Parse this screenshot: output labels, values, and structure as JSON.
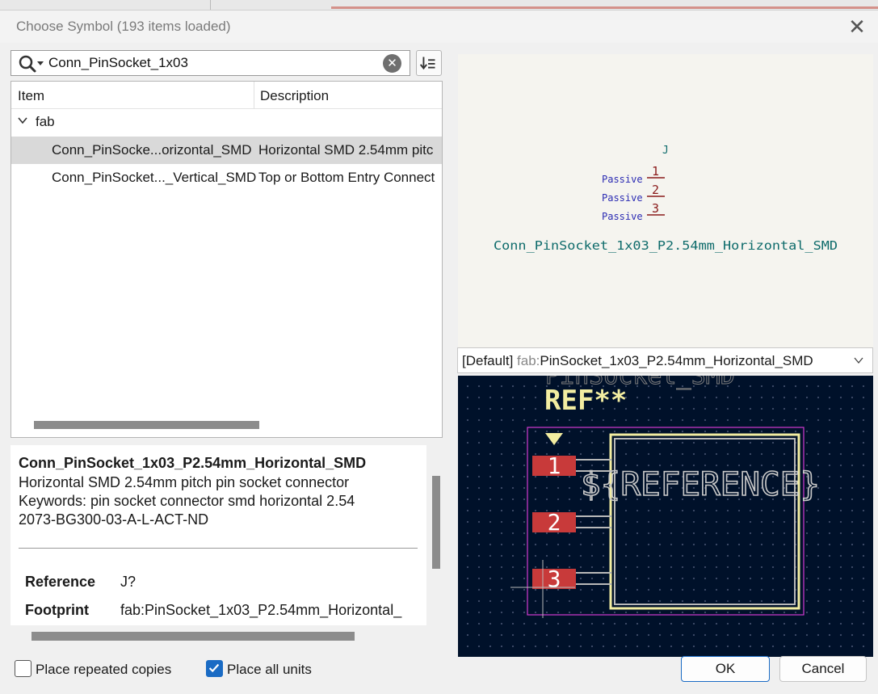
{
  "dialog": {
    "title": "Choose Symbol (193 items loaded)"
  },
  "search": {
    "value": "Conn_PinSocket_1x03",
    "clear_glyph": "✕"
  },
  "tree": {
    "columns": [
      "Item",
      "Description"
    ],
    "group": "fab",
    "rows": [
      {
        "name": "Conn_PinSocke...orizontal_SMD",
        "desc": "Horizontal SMD 2.54mm pitc"
      },
      {
        "name": "Conn_PinSocket..._Vertical_SMD",
        "desc": "Top or Bottom Entry Connect"
      }
    ]
  },
  "details": {
    "title": "Conn_PinSocket_1x03_P2.54mm_Horizontal_SMD",
    "lines": [
      "Horizontal SMD 2.54mm pitch pin socket connector",
      "Keywords: pin socket connector smd horizontal 2.54",
      "2073-BG300-03-A-L-ACT-ND"
    ],
    "fields": [
      {
        "key": "Reference",
        "value": "J?"
      },
      {
        "key": "Footprint",
        "value": "fab:PinSocket_1x03_P2.54mm_Horizontal_"
      }
    ]
  },
  "symbol_preview": {
    "reference": "J",
    "pins": [
      {
        "type": "Passive",
        "number": "1"
      },
      {
        "type": "Passive",
        "number": "2"
      },
      {
        "type": "Passive",
        "number": "3"
      }
    ],
    "value": "Conn_PinSocket_1x03_P2.54mm_Horizontal_SMD"
  },
  "footprint_select": {
    "prefix": "[Default] ",
    "lib": "fab:",
    "name": "PinSocket_1x03_P2.54mm_Horizontal_SMD"
  },
  "footprint_preview": {
    "ref_label": "REF**",
    "ref_field": "${REFERENCE}",
    "pads": [
      "1",
      "2",
      "3"
    ]
  },
  "footer": {
    "place_repeated": "Place repeated copies",
    "place_repeated_checked": false,
    "place_all_units": "Place all units",
    "place_all_units_checked": true,
    "ok": "OK",
    "cancel": "Cancel"
  },
  "colors": {
    "accent": "#1a6bc4",
    "pad_red": "#c83a3a",
    "silk_yellow": "#f2eda1",
    "courtyard_magenta": "#d23ad2",
    "pin_passive_blue": "#2b2bb3",
    "pin_number_red": "#8a1a1a",
    "value_teal": "#0e6b6b"
  }
}
